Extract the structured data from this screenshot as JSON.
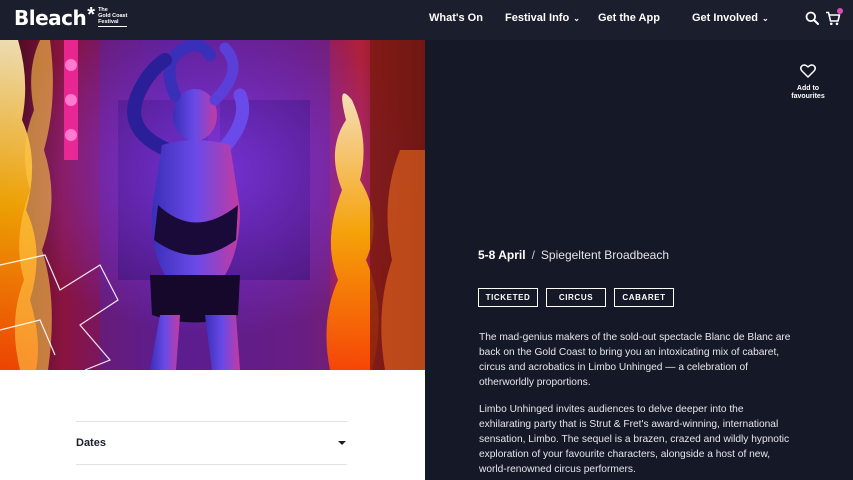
{
  "brand": {
    "name": "Bleach",
    "star": "*",
    "sub_lines": [
      "The",
      "Gold Coast",
      "Festival"
    ]
  },
  "nav": {
    "items": [
      {
        "label": "What's On",
        "has_dropdown": false
      },
      {
        "label": "Festival Info",
        "has_dropdown": true
      },
      {
        "label": "Get the App",
        "has_dropdown": false
      },
      {
        "label": "Get Involved",
        "has_dropdown": true
      }
    ],
    "dropdown_glyph": "⌄",
    "icons": [
      "search-icon",
      "cart-icon"
    ]
  },
  "favourite": {
    "label_line1": "Add to",
    "label_line2": "favourites",
    "icon": "heart-icon"
  },
  "event": {
    "date": "5-8 April",
    "separator": "/",
    "venue": "Spiegeltent Broadbeach",
    "tags": [
      "TICKETED",
      "CIRCUS",
      "CABARET"
    ],
    "paragraphs": [
      "The mad-genius makers of the sold-out spectacle Blanc de Blanc are back on the Gold Coast to bring you an intoxicating mix of cabaret, circus and acrobatics in Limbo Unhinged — a celebration of otherworldly proportions.",
      "Limbo Unhinged invites audiences to delve deeper into the exhilarating party that is Strut & Fret's award-winning, international sensation, Limbo. The sequel is a brazen, crazed and wildly hypnotic exploration of your favourite characters, alongside a host of new, world-renowned circus performers."
    ]
  },
  "accordion": {
    "dates_label": "Dates"
  },
  "colors": {
    "nav_bg": "#1b1e2c",
    "panel_bg": "#151826",
    "accent_pink": "#d84fb4"
  }
}
